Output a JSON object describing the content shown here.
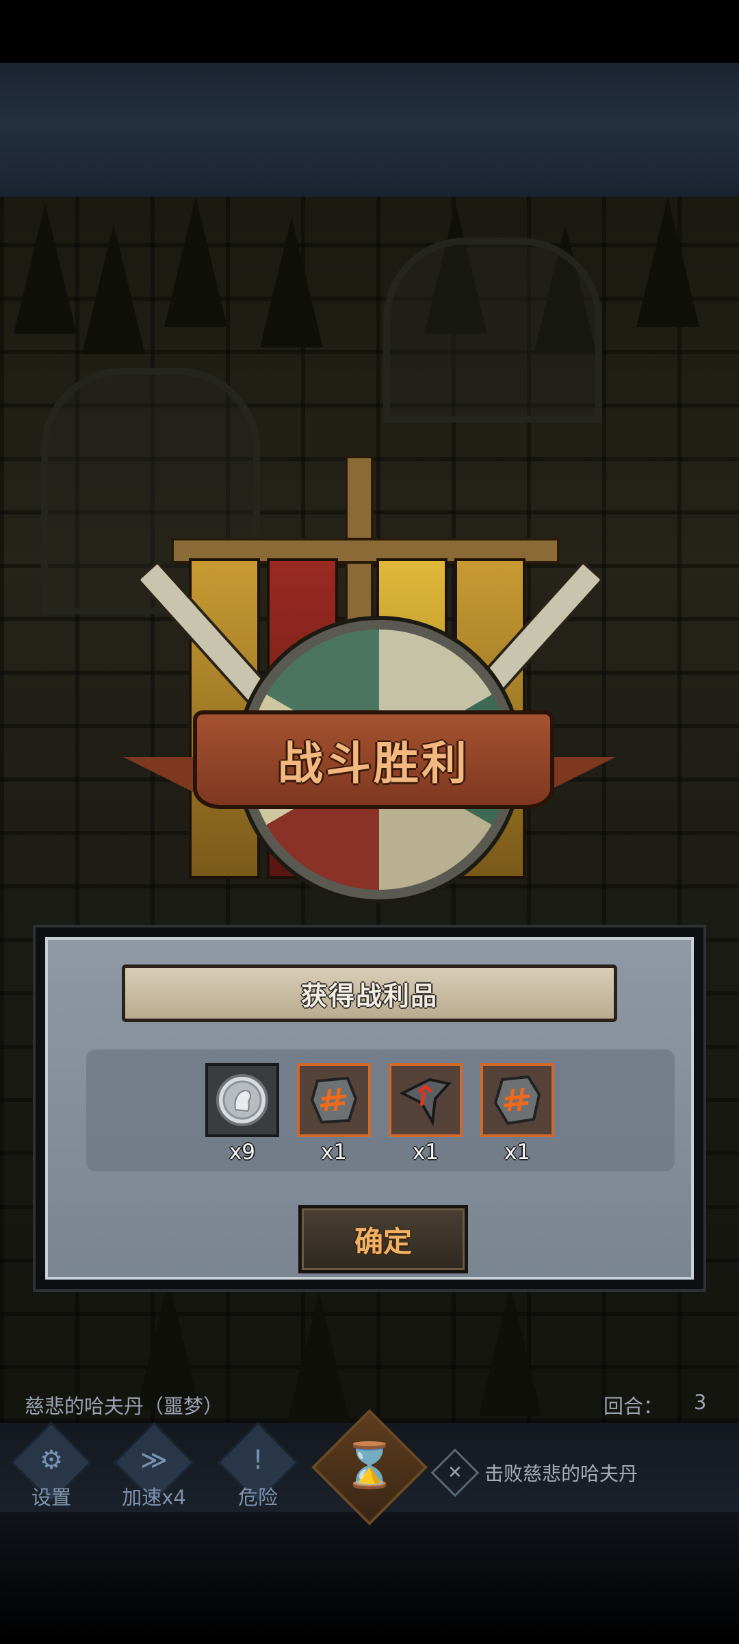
{
  "victory": {
    "title": "战斗胜利"
  },
  "dialog": {
    "header": "获得战利品",
    "loot": [
      {
        "icon": "silver-coin-icon",
        "quantity": "x9",
        "rarity": "common"
      },
      {
        "icon": "rune-stone-icon",
        "quantity": "x1",
        "rarity": "rare"
      },
      {
        "icon": "rune-shard-icon",
        "quantity": "x1",
        "rarity": "rare"
      },
      {
        "icon": "rune-stone-icon",
        "quantity": "x1",
        "rarity": "rare"
      }
    ],
    "confirm_label": "确定"
  },
  "status": {
    "boss_name": "慈悲的哈夫丹（噩梦）",
    "round_label": "回合：",
    "round_value": "3"
  },
  "hud": {
    "settings_label": "设置",
    "speed_label": "加速x4",
    "danger_label": "危险",
    "objective": "击败慈悲的哈夫丹"
  },
  "colors": {
    "accent_orange": "#f2b266",
    "rare_border": "#d06a2c",
    "ribbon": "#a55230"
  }
}
